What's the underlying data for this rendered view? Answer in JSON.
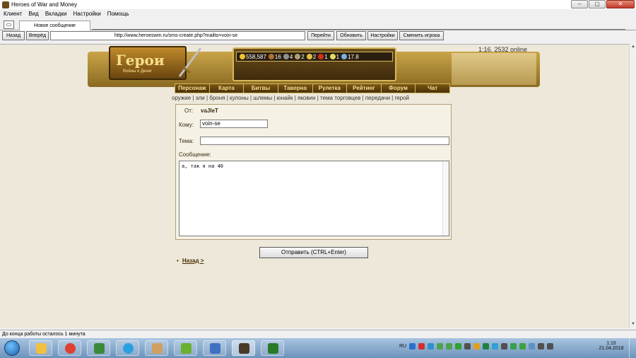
{
  "window": {
    "title": "Heroes of War and Money",
    "min": "‒",
    "max": "▢",
    "close": "✕"
  },
  "menu": [
    "Клиент",
    "Вид",
    "Вкладки",
    "Настройки",
    "Помощь"
  ],
  "tab": {
    "label": "Новое сообщение"
  },
  "nav": {
    "back": "Назад",
    "forward": "Вперёд",
    "url": "http://www.heroeswm.ru/sms-create.php?mailto=voin-se",
    "go": "Перейти",
    "refresh": "Обновить",
    "settings": "Настройки",
    "switch_player": "Сменить игрока"
  },
  "page": {
    "online": "1:16, 2532 online",
    "logo_title": "Герои",
    "logo_subtitle": "Войны и Денег",
    "resources": [
      {
        "value": "558,587",
        "color": "#f2c230",
        "icon": "gold-icon"
      },
      {
        "value": "16",
        "color": "#b07030",
        "icon": "wood-icon"
      },
      {
        "value": "4",
        "color": "#909090",
        "icon": "ore-icon"
      },
      {
        "value": "2",
        "color": "#b0a070",
        "icon": "mercury-icon"
      },
      {
        "value": "2",
        "color": "#e0c040",
        "icon": "sulfur-icon"
      },
      {
        "value": "1",
        "color": "#d03020",
        "icon": "crystal-icon"
      },
      {
        "value": "1",
        "color": "#e0e060",
        "icon": "gems-icon"
      },
      {
        "value": "17.8",
        "color": "#7ab0e0",
        "icon": "diamond-icon"
      }
    ],
    "game_nav": [
      "Персонаж",
      "Карта",
      "Битвы",
      "Таверна",
      "Рулетка",
      "Рейтинг",
      "Форум",
      "Чат"
    ],
    "sublinks": "оружие | эли | броня | кулоны | шлемы | юнайк | яковин | тема торговцев | передачи | герой"
  },
  "form": {
    "from_label": "От:",
    "from_value": "vaJIeT",
    "to_label": "Кому:",
    "to_value": "voin-se",
    "subject_label": "Тема:",
    "subject_value": "",
    "message_label": "Сообщение:",
    "message_value": "а, так я на 40",
    "send": "Отправить (CTRL+Enter)",
    "back": "Назад >"
  },
  "status": "До конца работы осталось 1 минута",
  "taskbar": {
    "lang": "RU",
    "time": "1:16",
    "date": "21.04.2018",
    "apps": [
      {
        "name": "explorer",
        "color": "#f0c040"
      },
      {
        "name": "chrome",
        "color": "#e04030"
      },
      {
        "name": "evernote",
        "color": "#3a8a3a"
      },
      {
        "name": "skype",
        "color": "#2aa0e0"
      },
      {
        "name": "paint",
        "color": "#d0a060"
      },
      {
        "name": "utorrent",
        "color": "#6ab030"
      },
      {
        "name": "remote",
        "color": "#4070c0"
      },
      {
        "name": "heroes",
        "color": "#4a3a2a"
      },
      {
        "name": "evernote2",
        "color": "#2a7a2a"
      }
    ],
    "tray_colors": [
      "#2a70d0",
      "#d03030",
      "#3090d0",
      "#50a050",
      "#50a050",
      "#30a030",
      "#505050",
      "#e0a020",
      "#208040",
      "#30a0d0",
      "#505050",
      "#3aa050",
      "#40a040",
      "#6090c0",
      "#505050",
      "#505050"
    ]
  }
}
